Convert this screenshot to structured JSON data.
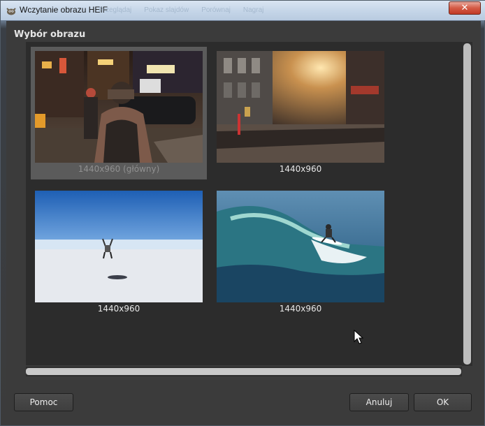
{
  "window": {
    "title": "Wczytanie obrazu HEIF",
    "close_label": "✕",
    "background_toolbar": [
      "Przeglądaj",
      "Pokaz slajdów",
      "Porównaj",
      "Nagraj"
    ]
  },
  "dialog": {
    "heading": "Wybór obrazu",
    "thumbnails": [
      {
        "label": "1440x960 (główny)",
        "scene": "city-street-night",
        "selected": true
      },
      {
        "label": "1440x960",
        "scene": "london-street-sunset",
        "selected": false
      },
      {
        "label": "1440x960",
        "scene": "salt-flat-jump",
        "selected": false
      },
      {
        "label": "1440x960",
        "scene": "surfer-wave",
        "selected": false
      }
    ],
    "buttons": {
      "help": "Pomoc",
      "cancel": "Anuluj",
      "ok": "OK"
    }
  },
  "colors": {
    "dialog_bg": "#3b3b3b",
    "content_bg": "#2c2c2c",
    "selected_bg": "#5b5b5b",
    "close_button": "#c8472f"
  }
}
